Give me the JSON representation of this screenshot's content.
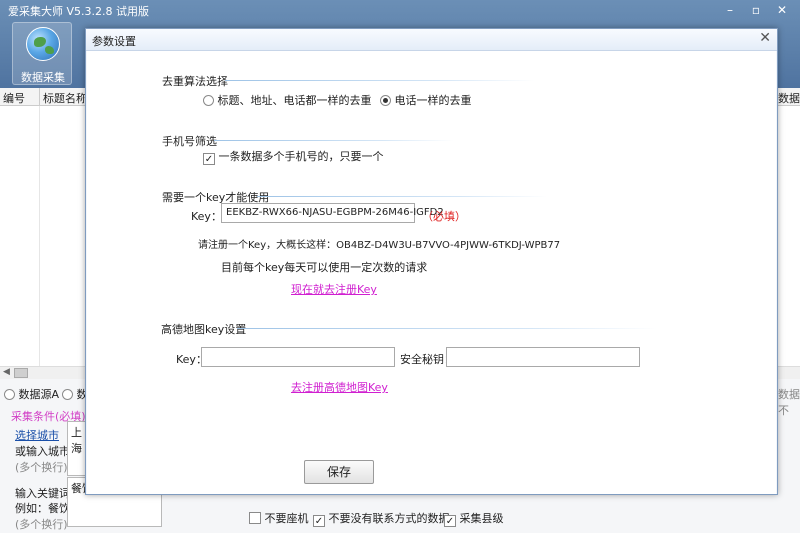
{
  "app": {
    "title": "爱采集大师 V5.3.2.8 试用版",
    "toolbar_button": "数据采集",
    "min_icon": "minimize-icon",
    "max_icon": "maximize-icon",
    "close_icon": "close-icon"
  },
  "grid": {
    "columns": [
      "编号",
      "标题名称"
    ],
    "right_column": "数据源"
  },
  "bottom": {
    "source_a": "数据源A",
    "source_b_partial": "数",
    "condition_title": "采集条件(必填)",
    "select_city": "选择城市",
    "or_input_city": "或输入城市",
    "multi_line_1": "(多个换行)",
    "city_value": "上海",
    "keyword_label": "输入关键词",
    "example": "例如：餐饮",
    "multi_line_2": "(多个换行)",
    "keyword_value": "餐饮",
    "right_partial": "数据不",
    "options": [
      {
        "label": "不要座机",
        "checked": false
      },
      {
        "label": "不要没有联系方式的数据",
        "checked": true
      },
      {
        "label": "采集县级",
        "checked": true
      }
    ]
  },
  "dialog": {
    "title": "参数设置",
    "dedup": {
      "title": "去重算法选择",
      "option1": "标题、地址、电话都一样的去重",
      "option2": "电话一样的去重",
      "selected": "option2"
    },
    "phone": {
      "title": "手机号筛选",
      "checkbox_label": "一条数据多个手机号的，只要一个",
      "checked": true
    },
    "key_section": {
      "title": "需要一个key才能使用",
      "key_label": "Key：",
      "key_value": "EEKBZ-RWX66-NJASU-EGBPM-26M46-IGFD2",
      "required": "（必填）",
      "hint": "请注册一个Key，大概长这样：OB4BZ-D4W3U-B7VVO-4PJWW-6TKDJ-WPB77",
      "hint2": "目前每个key每天可以使用一定次数的请求",
      "register_link": "现在就去注册Key"
    },
    "amap": {
      "title": "高德地图key设置",
      "key_label": "Key：",
      "key_value": "",
      "secret_label": "安全秘钥：",
      "secret_value": "",
      "register_link": "去注册高德地图Key"
    },
    "save_label": "保存",
    "close_icon": "close-icon"
  }
}
